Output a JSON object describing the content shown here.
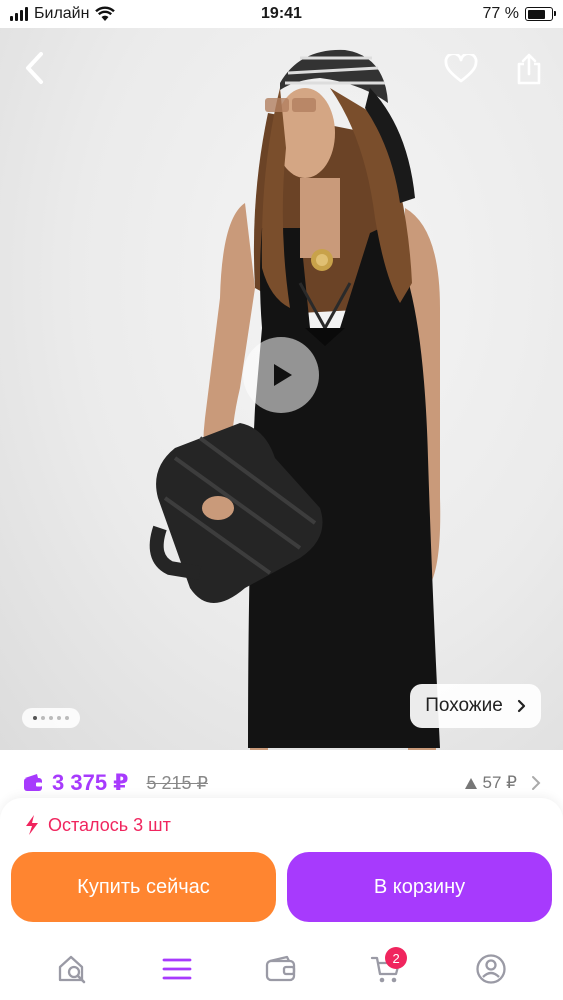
{
  "status_bar": {
    "carrier": "Билайн",
    "time": "19:41",
    "battery_percent": "77 %",
    "battery_level": 0.77
  },
  "product": {
    "image_alt": "Черное платье-макси без рукавов",
    "gallery": {
      "total": 5,
      "active_index": 0
    },
    "similar_label": "Похожие",
    "price": "3 375 ₽",
    "old_price": "5 215 ₽",
    "price_delta": "57 ₽",
    "stock_label": "Осталось 3 шт"
  },
  "actions": {
    "buy_now_label": "Купить сейчас",
    "add_to_cart_label": "В корзину"
  },
  "tabbar": {
    "items": [
      {
        "icon": "home-search-icon"
      },
      {
        "icon": "catalog-menu-icon",
        "active": true
      },
      {
        "icon": "wallet-icon"
      },
      {
        "icon": "cart-icon",
        "badge": "2"
      },
      {
        "icon": "profile-icon"
      }
    ]
  },
  "colors": {
    "accent_purple": "#a73afd",
    "accent_orange": "#ff8530",
    "alert_red": "#f0255e"
  }
}
